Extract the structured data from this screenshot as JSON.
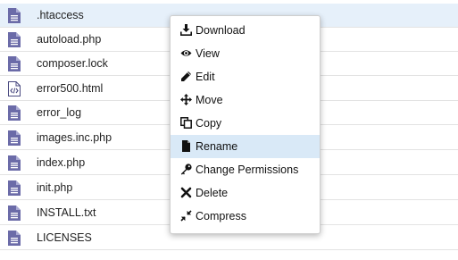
{
  "files": [
    {
      "name": ".htaccess",
      "icon": "file-icon",
      "selected": true
    },
    {
      "name": "autoload.php",
      "icon": "file-icon",
      "selected": false
    },
    {
      "name": "composer.lock",
      "icon": "file-icon",
      "selected": false
    },
    {
      "name": "error500.html",
      "icon": "code-file-icon",
      "selected": false
    },
    {
      "name": "error_log",
      "icon": "file-icon",
      "selected": false
    },
    {
      "name": "images.inc.php",
      "icon": "file-icon",
      "selected": false
    },
    {
      "name": "index.php",
      "icon": "file-icon",
      "selected": false
    },
    {
      "name": "init.php",
      "icon": "file-icon",
      "selected": false
    },
    {
      "name": "INSTALL.txt",
      "icon": "file-icon",
      "selected": false
    },
    {
      "name": "LICENSES",
      "icon": "file-icon",
      "selected": false
    }
  ],
  "context_menu": {
    "items": [
      {
        "label": "Download",
        "icon": "download-icon",
        "active": false
      },
      {
        "label": "View",
        "icon": "eye-icon",
        "active": false
      },
      {
        "label": "Edit",
        "icon": "pencil-icon",
        "active": false
      },
      {
        "label": "Move",
        "icon": "move-arrows-icon",
        "active": false
      },
      {
        "label": "Copy",
        "icon": "copy-icon",
        "active": false
      },
      {
        "label": "Rename",
        "icon": "file-icon",
        "active": true
      },
      {
        "label": "Change Permissions",
        "icon": "key-icon",
        "active": false
      },
      {
        "label": "Delete",
        "icon": "x-icon",
        "active": false
      },
      {
        "label": "Compress",
        "icon": "compress-icon",
        "active": false
      }
    ]
  },
  "colors": {
    "file_icon": "#6b6ba8",
    "selected_row": "#e6f0fa",
    "active_menu_item": "#d9e9f7",
    "menu_icon": "#111111"
  }
}
